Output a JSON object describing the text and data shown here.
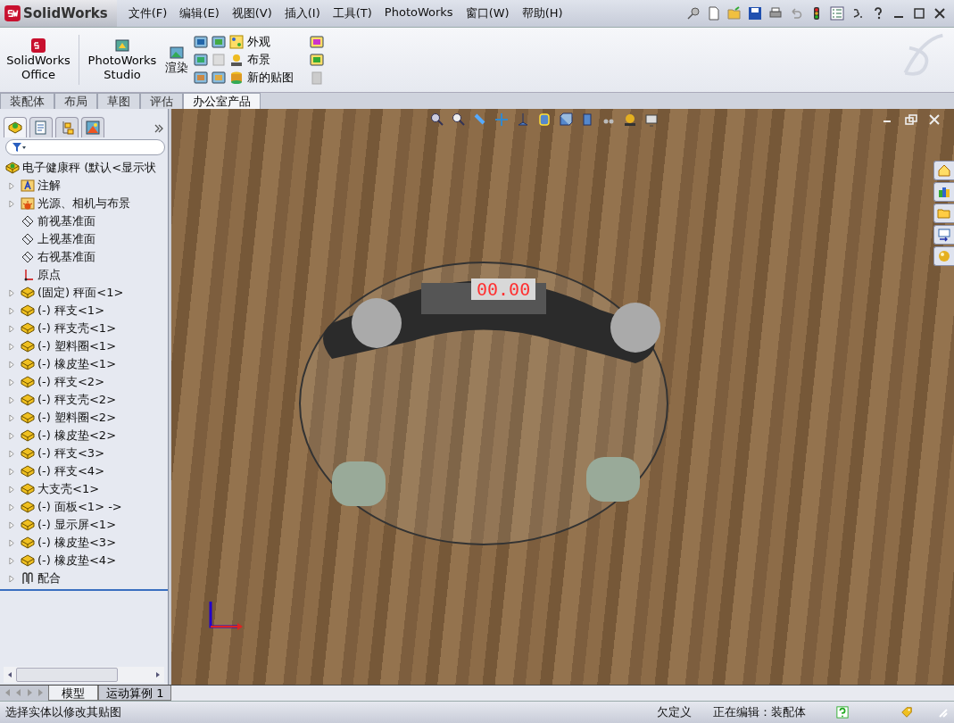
{
  "app": {
    "logo": "SolidWorks"
  },
  "menu": [
    "文件(F)",
    "编辑(E)",
    "视图(V)",
    "插入(I)",
    "工具(T)",
    "PhotoWorks",
    "窗口(W)",
    "帮助(H)"
  ],
  "ribbon": {
    "office_button": "SolidWorks Office",
    "studio_button": "PhotoWorks Studio",
    "render_button": "渲染",
    "commands": [
      "外观",
      "布景",
      "新的贴图"
    ]
  },
  "command_tabs": [
    {
      "label": "装配体",
      "selected": false
    },
    {
      "label": "布局",
      "selected": false
    },
    {
      "label": "草图",
      "selected": false
    },
    {
      "label": "评估",
      "selected": false
    },
    {
      "label": "办公室产品",
      "selected": true
    }
  ],
  "feature_tree": {
    "label": "电子健康秤  (默认<显示状",
    "kind": "assembly",
    "children": [
      {
        "label": "注解",
        "kind": "annotations",
        "collapsible": true
      },
      {
        "label": "光源、相机与布景",
        "kind": "lights",
        "collapsible": true
      },
      {
        "label": "前视基准面",
        "kind": "plane",
        "collapsible": false
      },
      {
        "label": "上视基准面",
        "kind": "plane",
        "collapsible": false
      },
      {
        "label": "右视基准面",
        "kind": "plane",
        "collapsible": false
      },
      {
        "label": "原点",
        "kind": "origin",
        "collapsible": false
      },
      {
        "label": "(固定) 秤面<1>",
        "kind": "part",
        "collapsible": true
      },
      {
        "label": "(-) 秤支<1>",
        "kind": "part",
        "collapsible": true
      },
      {
        "label": "(-) 秤支壳<1>",
        "kind": "part",
        "collapsible": true
      },
      {
        "label": "(-) 塑料圈<1>",
        "kind": "part",
        "collapsible": true
      },
      {
        "label": "(-) 橡皮垫<1>",
        "kind": "part",
        "collapsible": true
      },
      {
        "label": "(-) 秤支<2>",
        "kind": "part",
        "collapsible": true
      },
      {
        "label": "(-) 秤支壳<2>",
        "kind": "part",
        "collapsible": true
      },
      {
        "label": "(-) 塑料圈<2>",
        "kind": "part",
        "collapsible": true
      },
      {
        "label": "(-) 橡皮垫<2>",
        "kind": "part",
        "collapsible": true
      },
      {
        "label": "(-) 秤支<3>",
        "kind": "part",
        "collapsible": true
      },
      {
        "label": "(-) 秤支<4>",
        "kind": "part",
        "collapsible": true
      },
      {
        "label": "大支壳<1>",
        "kind": "part",
        "collapsible": true
      },
      {
        "label": "(-) 面板<1> ->",
        "kind": "part",
        "collapsible": true
      },
      {
        "label": "(-) 显示屏<1>",
        "kind": "part",
        "collapsible": true
      },
      {
        "label": "(-) 橡皮垫<3>",
        "kind": "part",
        "collapsible": true
      },
      {
        "label": "(-) 橡皮垫<4>",
        "kind": "part",
        "collapsible": true
      },
      {
        "label": "配合",
        "kind": "mates",
        "collapsible": true
      }
    ]
  },
  "viewport": {
    "display_reading": "00.00"
  },
  "bottom_tabs": [
    {
      "label": "模型",
      "selected": true
    },
    {
      "label": "运动算例 1",
      "selected": false
    }
  ],
  "status_bar": {
    "message": "选择实体以修改其贴图",
    "definition": "欠定义",
    "editing": "正在编辑：装配体"
  }
}
